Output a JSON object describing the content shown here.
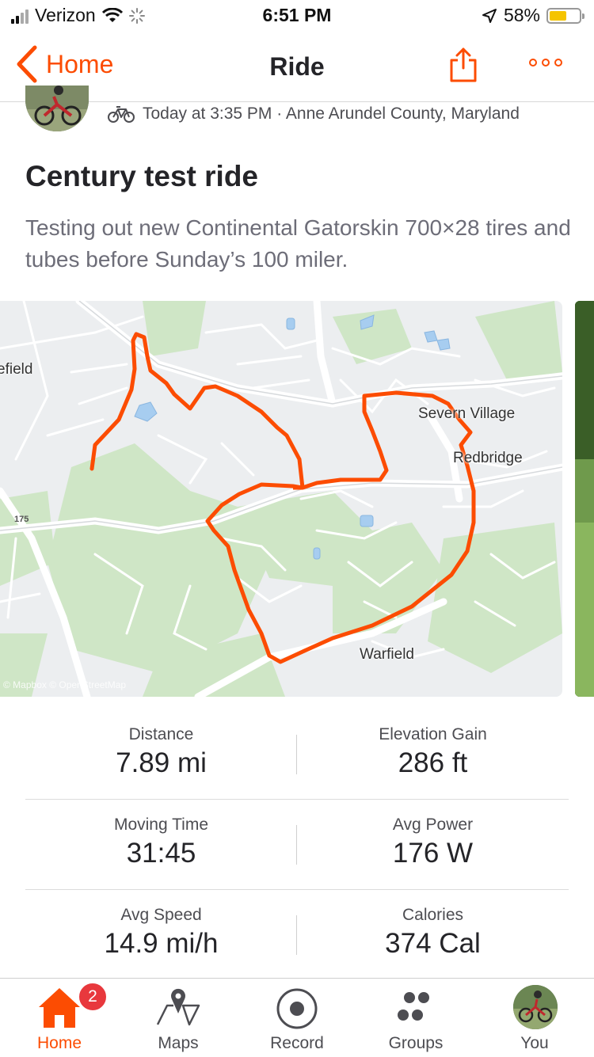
{
  "status_bar": {
    "carrier": "Verizon",
    "time": "6:51 PM",
    "battery": "58%",
    "battery_level": 0.58
  },
  "nav": {
    "back_label": "Home",
    "title": "Ride"
  },
  "activity": {
    "meta": "Today at 3:35 PM · Anne Arundel County, Maryland",
    "title": "Century test ride",
    "description": "Testing out new Continental Gatorskin 700×28 tires and tubes before Sunday’s 100 miler."
  },
  "map": {
    "labels": {
      "place_left": "efield",
      "severn_village": "Severn Village",
      "redbridge": "Redbridge",
      "warfield": "Warfield",
      "road_175": "175",
      "attribution": "© Mapbox © OpenStreetMap"
    },
    "route_color": "#fc4c02"
  },
  "stats": [
    {
      "left": {
        "label": "Distance",
        "value": "7.89 mi"
      },
      "right": {
        "label": "Elevation Gain",
        "value": "286 ft"
      }
    },
    {
      "left": {
        "label": "Moving Time",
        "value": "31:45"
      },
      "right": {
        "label": "Avg Power",
        "value": "176 W"
      }
    },
    {
      "left": {
        "label": "Avg Speed",
        "value": "14.9 mi/h"
      },
      "right": {
        "label": "Calories",
        "value": "374 Cal"
      }
    }
  ],
  "tab_bar": {
    "home": {
      "label": "Home",
      "badge": "2"
    },
    "maps": {
      "label": "Maps"
    },
    "record": {
      "label": "Record"
    },
    "groups": {
      "label": "Groups"
    },
    "you": {
      "label": "You"
    }
  },
  "colors": {
    "accent": "#fc4c02",
    "badge": "#e8383d"
  }
}
